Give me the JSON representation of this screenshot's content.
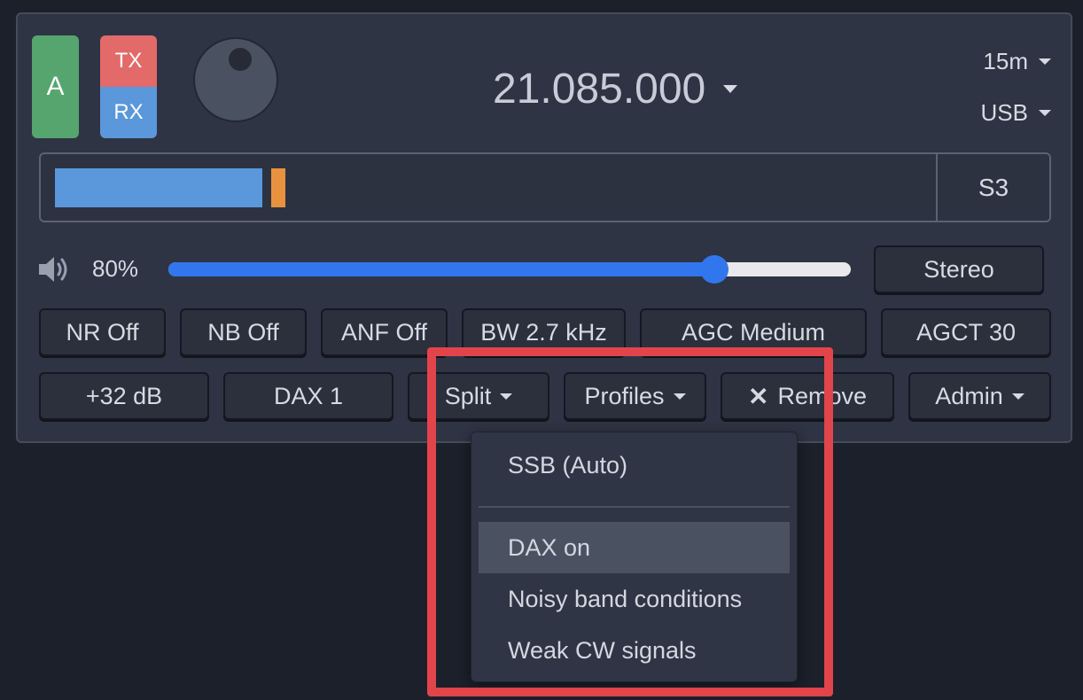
{
  "slice": {
    "letter": "A",
    "tx_label": "TX",
    "rx_label": "RX"
  },
  "frequency": {
    "value": "21.085.000"
  },
  "band": {
    "value": "15m"
  },
  "mode": {
    "value": "USB"
  },
  "meter": {
    "level": 0.236,
    "peak": 0.246,
    "label": "S3"
  },
  "audio": {
    "volume_label": "80%",
    "volume": 0.8,
    "stereo_label": "Stereo"
  },
  "dsp_buttons": {
    "nr": "NR Off",
    "nb": "NB Off",
    "anf": "ANF Off",
    "bw": "BW 2.7 kHz",
    "agc": "AGC Medium",
    "agct": "AGCT 30"
  },
  "action_buttons": {
    "gain": "+32 dB",
    "dax": "DAX 1",
    "split": "Split",
    "profiles": "Profiles",
    "remove": "Remove",
    "admin": "Admin"
  },
  "profiles_menu": {
    "items": [
      "SSB (Auto)",
      "DAX on",
      "Noisy band conditions",
      "Weak CW signals"
    ],
    "highlighted": "DAX on"
  },
  "icons": {
    "speaker": "speaker-volume-icon",
    "remove": "close-x-icon",
    "caret": "caret-down-icon"
  },
  "colors": {
    "slice_badge": "#56a46e",
    "tx": "#e26a68",
    "rx": "#5a98db",
    "meter_fill": "#5a98db",
    "meter_peak": "#e8923f",
    "slider": "#3176ec",
    "annotation": "#e2444b"
  }
}
